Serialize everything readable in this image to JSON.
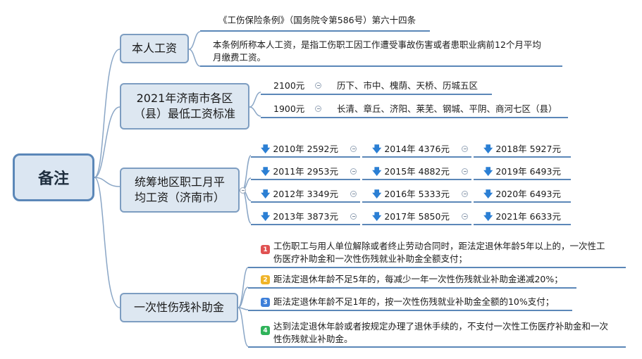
{
  "root": {
    "label": "备注"
  },
  "branches": {
    "wage": {
      "label": "本人工资",
      "source": "《工伤保险条例》（国务院令第586号）第六十四条",
      "definition_line1": "本条例所称本人工资，是指工伤职工因工作遭受事故伤害或者患职业病前12个月平均",
      "definition_line2": "月缴费工资。"
    },
    "minwage": {
      "label_line1": "2021年济南市各区",
      "label_line2": "（县）最低工资标准",
      "tiers": [
        {
          "amount": "2100元",
          "areas": "历下、市中、槐荫、天桥、历城五区"
        },
        {
          "amount": "1900元",
          "areas": "长清、章丘、济阳、莱芜、钢城、平阴、商河七区（县）"
        }
      ]
    },
    "avgwage": {
      "label_line1": "统筹地区职工月平",
      "label_line2": "均工资（济南市）",
      "col1": [
        "2010年 2592元",
        "2011年 2953元",
        "2012年 3349元",
        "2013年 3873元"
      ],
      "col2": [
        "2014年 4376元",
        "2015年 4882元",
        "2016年 5333元",
        "2017年 5850元"
      ],
      "col3": [
        "2018年 5927元",
        "2019年 6493元",
        "2020年 6493元",
        "2021年 6633元"
      ]
    },
    "subsidy": {
      "label": "一次性伤残补助金",
      "items": [
        {
          "badge": "1",
          "color": "#e05252",
          "line1": "工伤职工与用人单位解除或者终止劳动合同时，距法定退休年龄5年以上的，一次性工",
          "line2": "伤医疗补助金和一次性伤残就业补助金全额支付；"
        },
        {
          "badge": "2",
          "color": "#f0b429",
          "line1": "距法定退休年龄不足5年的，每减少一年一次性伤残就业补助金递减20%；",
          "line2": ""
        },
        {
          "badge": "3",
          "color": "#3d7fd9",
          "line1": "距法定退休年龄不足1年的，按一次性伤残就业补助金全额的10%支付；",
          "line2": ""
        },
        {
          "badge": "4",
          "color": "#2fb35a",
          "line1": "达到法定退休年龄或者按规定办理了退休手续的，不支付一次性工伤医疗补助金和一次",
          "line2": "性伤残就业补助金。"
        }
      ]
    }
  },
  "colors": {
    "line": "#5b87b8",
    "node_fill": "#dde7f1",
    "arrow": "#2b7fd4"
  },
  "icons": {
    "arrow": "down-arrow-icon",
    "collapse": "collapse-toggle-icon"
  }
}
